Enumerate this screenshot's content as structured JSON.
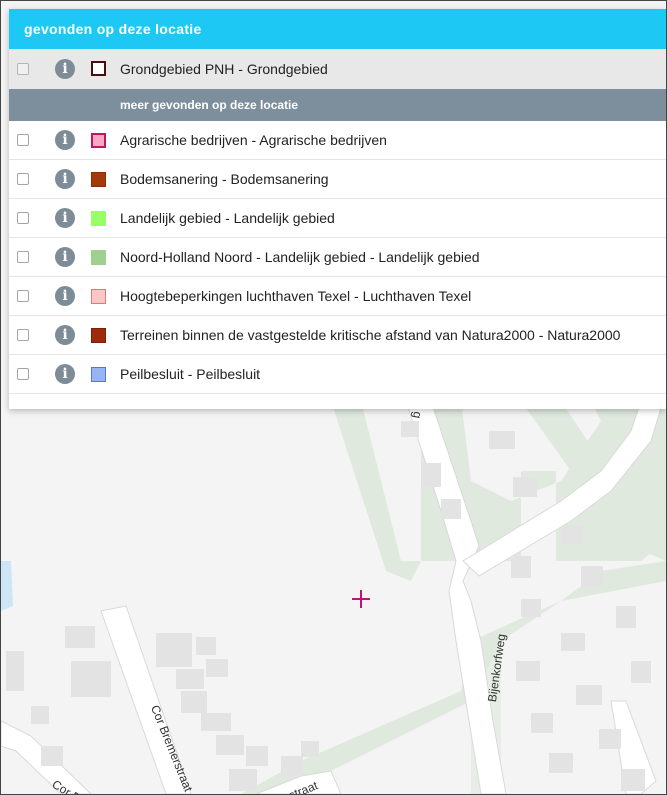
{
  "panel": {
    "title": "gevonden op deze locatie",
    "primary": {
      "label": "Grondgebied PNH - Grondgebied",
      "swatch_fill": "#ffffff",
      "swatch_border": "#4a0d0d"
    },
    "more_header": "meer gevonden op deze locatie",
    "items": [
      {
        "label": "Agrarische bedrijven - Agrarische bedrijven",
        "swatch_fill": "#f7a8c4",
        "swatch_border": "#c0185b"
      },
      {
        "label": "Bodemsanering - Bodemsanering",
        "swatch_fill": "#a33a0a",
        "swatch_border": "#8a2e06"
      },
      {
        "label": "Landelijk gebied - Landelijk gebied",
        "swatch_fill": "#99ff66",
        "swatch_border": "#99ff66"
      },
      {
        "label": "Noord-Holland Noord - Landelijk gebied - Landelijk gebied",
        "swatch_fill": "#a0d090",
        "swatch_border": "#a0d090"
      },
      {
        "label": "Hoogtebeperkingen luchthaven Texel - Luchthaven Texel",
        "swatch_fill": "#fcc6c6",
        "swatch_border": "#e07a7a"
      },
      {
        "label": "Terreinen binnen de vastgestelde kritische afstand van Natura2000 - Natura2000",
        "swatch_fill": "#9c2c0a",
        "swatch_border": "#7a2208"
      },
      {
        "label": "Peilbesluit - Peilbesluit",
        "swatch_fill": "#97b4f5",
        "swatch_border": "#5a78c8"
      }
    ]
  },
  "map": {
    "streets": {
      "s1": "Bijenkorfweg",
      "s2": "Cor Bremerstraat",
      "s3": "Cor B",
      "s4": "rstraat",
      "s5": "g"
    },
    "colors": {
      "background": "#f4f4f4",
      "green": "#dfe9de",
      "road": "#ffffff",
      "road_edge": "#d9d9d9",
      "building": "#e3e3e3",
      "crosshair": "#c0127a",
      "water": "#cde6f5"
    }
  }
}
